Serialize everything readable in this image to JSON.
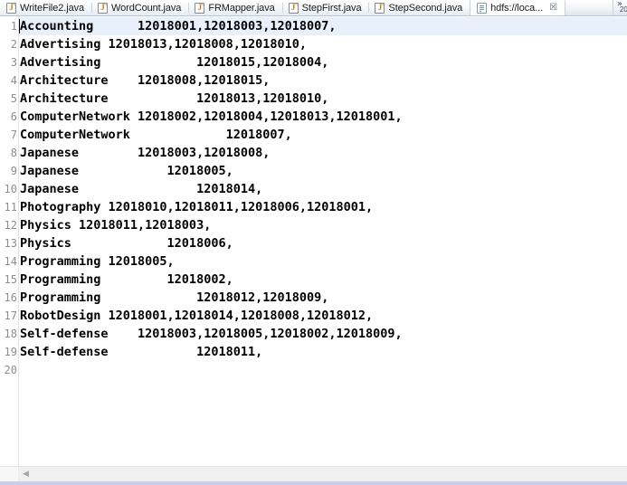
{
  "window": {
    "title": "hdfs://loca..."
  },
  "tabbar": {
    "tabs": [
      {
        "label": "WriteFile2.java",
        "icon": "java-file-icon",
        "active": false,
        "closable": false
      },
      {
        "label": "WordCount.java",
        "icon": "java-file-icon",
        "active": false,
        "closable": false
      },
      {
        "label": "FRMapper.java",
        "icon": "java-file-icon",
        "active": false,
        "closable": false
      },
      {
        "label": "StepFirst.java",
        "icon": "java-file-icon",
        "active": false,
        "closable": false
      },
      {
        "label": "StepSecond.java",
        "icon": "java-file-icon",
        "active": false,
        "closable": false
      },
      {
        "label": "hdfs://loca...",
        "icon": "text-file-icon",
        "active": true,
        "closable": true
      }
    ],
    "close_glyph": "☒",
    "overflow": {
      "chevron": "»",
      "count": "20"
    }
  },
  "editor": {
    "current_line": 1,
    "caret_line": 1,
    "caret_column": 1,
    "highlight_color": "#e8f1fb",
    "line_numbers": [
      "1",
      "2",
      "3",
      "4",
      "5",
      "6",
      "7",
      "8",
      "9",
      "10",
      "11",
      "12",
      "13",
      "14",
      "15",
      "16",
      "17",
      "18",
      "19",
      "20"
    ],
    "lines": [
      "Accounting      12018001,12018003,12018007,",
      "Advertising 12018013,12018008,12018010,",
      "Advertising             12018015,12018004,",
      "Architecture    12018008,12018015,",
      "Architecture            12018013,12018010,",
      "ComputerNetwork 12018002,12018004,12018013,12018001,",
      "ComputerNetwork             12018007,",
      "Japanese        12018003,12018008,",
      "Japanese            12018005,",
      "Japanese                12018014,",
      "Photography 12018010,12018011,12018006,12018001,",
      "Physics 12018011,12018003,",
      "Physics             12018006,",
      "Programming 12018005,",
      "Programming         12018002,",
      "Programming             12018012,12018009,",
      "RobotDesign 12018001,12018014,12018008,12018012,",
      "Self-defense    12018003,12018005,12018002,12018009,",
      "Self-defense            12018011,",
      ""
    ]
  },
  "scrollbar": {
    "left_arrow_glyph": "◀",
    "orientation": "horizontal"
  }
}
